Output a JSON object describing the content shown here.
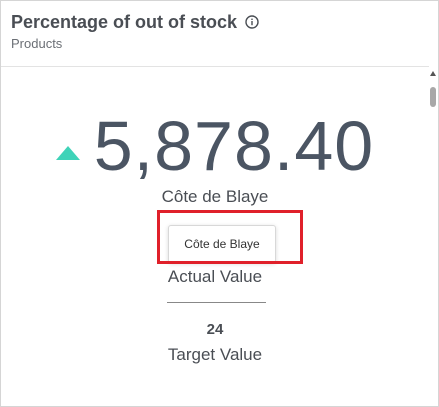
{
  "widget": {
    "title": "Percentage of out of stock",
    "subtitle": "Products"
  },
  "kpi": {
    "value": "5,878.40",
    "trend": "up",
    "actual_name": "Côte de Blaye",
    "actual_caption": "Actual Value",
    "target_value": "24",
    "target_caption": "Target Value"
  },
  "tooltip": {
    "text": "Côte de Blaye"
  },
  "colors": {
    "trend_up": "#3fd3b8",
    "highlight": "#e0202a",
    "value_text": "#4b5563"
  },
  "icons": {
    "info": "info-icon",
    "trend": "triangle-up-icon"
  }
}
